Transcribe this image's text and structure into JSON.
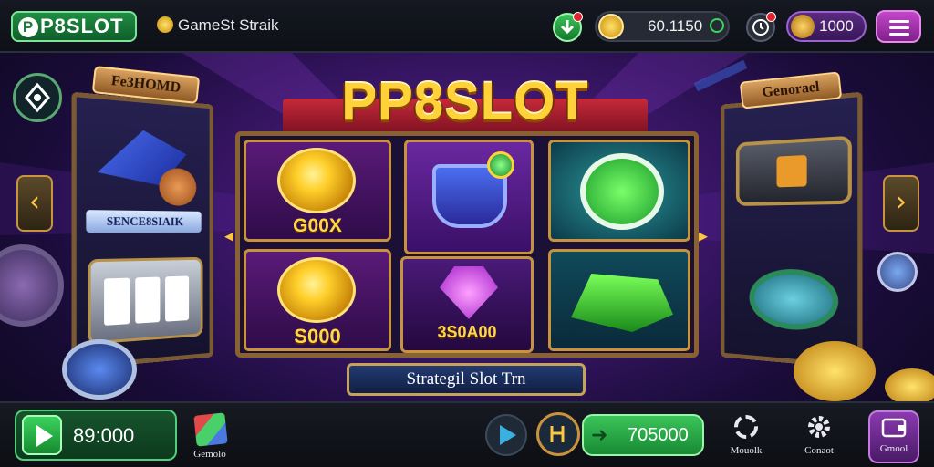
{
  "header": {
    "logo_text": "P8SLOT",
    "logo_chip": "P",
    "game_title": "GameSt Straik",
    "coin_balance": "60.1150",
    "gem_balance": "1000"
  },
  "main": {
    "title": "PP8SLOT",
    "left_card_label": "Fe3HOMD",
    "left_card_sign": "SENCE8SIAIK",
    "right_card_label": "Genorael",
    "tiles": [
      {
        "label": "G00X"
      },
      {
        "label": "S000"
      },
      {
        "label": ""
      },
      {
        "label": "3S0A00"
      },
      {
        "label": ""
      },
      {
        "label": ""
      }
    ],
    "strategy_label": "Strategil Slot Trn"
  },
  "footer": {
    "bet_value": "89:000",
    "games_label": "Gemolo",
    "win_value": "705000",
    "refresh_label": "Mouolk",
    "settings_label": "Conaot",
    "wallet_label": "Gmool"
  },
  "icons": {
    "refresh": "refresh-icon",
    "settings": "gear-icon",
    "wallet": "wallet-icon",
    "menu": "hamburger-menu-icon"
  },
  "colors": {
    "accent_green": "#3bd25e",
    "accent_purple": "#c247c9",
    "gold": "#ffd23a",
    "frame_brown": "#8a6232"
  }
}
